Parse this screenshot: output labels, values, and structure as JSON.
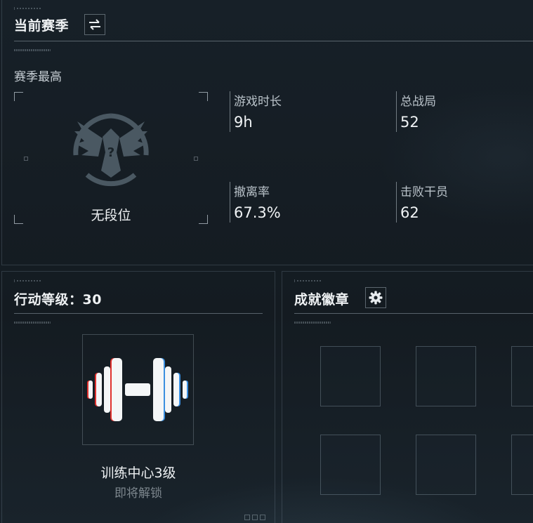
{
  "season": {
    "title": "当前赛季",
    "switch_icon": "swap-arrows-icon",
    "best_label": "赛季最高",
    "rank_name": "无段位",
    "rank_icon": "eagle-emblem-icon",
    "stats": [
      {
        "label": "游戏时长",
        "value": "9h"
      },
      {
        "label": "总战局",
        "value": "52"
      },
      {
        "label": "撤离率",
        "value": "67.3%"
      },
      {
        "label": "击败干员",
        "value": "62"
      }
    ]
  },
  "level": {
    "title": "行动等级：30",
    "icon": "dumbbell-icon",
    "facility_name": "训练中心3级",
    "status": "即将解锁"
  },
  "achievements": {
    "title": "成就徽章",
    "settings_icon": "gear-icon"
  },
  "colors": {
    "background": "#151c22",
    "text_primary": "#eef1f3",
    "text_muted": "#7c868d",
    "dumbbell_accent_red": "#e0322f",
    "dumbbell_accent_blue": "#3a8fe0"
  }
}
